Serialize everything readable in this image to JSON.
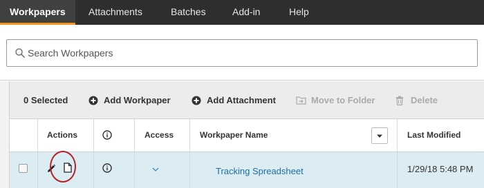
{
  "nav": {
    "tabs": [
      {
        "label": "Workpapers",
        "active": true
      },
      {
        "label": "Attachments",
        "active": false
      },
      {
        "label": "Batches",
        "active": false
      },
      {
        "label": "Add-in",
        "active": false
      },
      {
        "label": "Help",
        "active": false
      }
    ],
    "accent_color": "#f7941d"
  },
  "search": {
    "placeholder": "Search Workpapers",
    "icon": "search-icon"
  },
  "toolbar": {
    "selected_label": "0 Selected",
    "add_workpaper_label": "Add Workpaper",
    "add_attachment_label": "Add Attachment",
    "move_to_folder_label": "Move to Folder",
    "delete_label": "Delete"
  },
  "table": {
    "columns": {
      "actions": "Actions",
      "info": "info-icon",
      "access": "Access",
      "name": "Workpaper Name",
      "modified": "Last Modified"
    },
    "rows": [
      {
        "name": "Tracking Spreadsheet",
        "last_modified": "1/29/18 5:48 PM",
        "selected": false,
        "highlight_color": "#dbedf3"
      }
    ]
  }
}
